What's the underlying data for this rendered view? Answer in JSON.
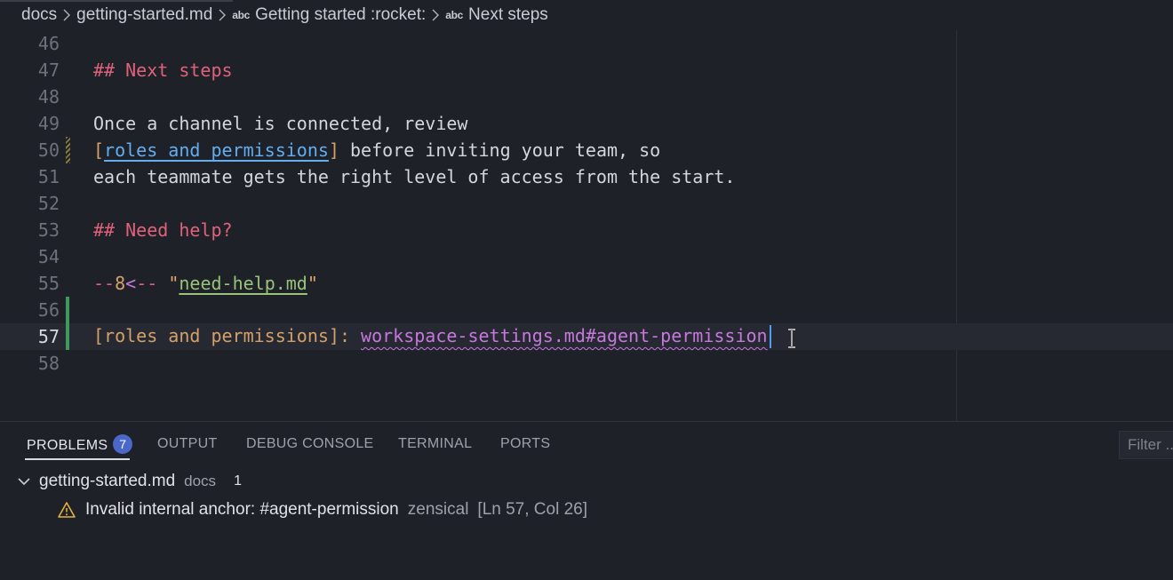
{
  "breadcrumb": {
    "items": [
      {
        "label": "docs",
        "symbol": ""
      },
      {
        "label": "getting-started.md",
        "symbol": ""
      },
      {
        "label": "Getting started :rocket:",
        "symbol": "abc"
      },
      {
        "label": "Next steps",
        "symbol": "abc"
      }
    ]
  },
  "editor": {
    "line_numbers": [
      "46",
      "47",
      "48",
      "49",
      "50",
      "51",
      "52",
      "53",
      "54",
      "55",
      "56",
      "57",
      "58"
    ],
    "current_line": "57",
    "lines": {
      "l47": "## Next steps",
      "l49": "Once a channel is connected, review",
      "l50_open": "[",
      "l50_link": "roles and permissions",
      "l50_close": "]",
      "l50_rest": " before inviting your team, so",
      "l51": "each teammate gets the right level of access from the start.",
      "l53": "## Need help?",
      "l55_dash": "--",
      "l55_num": "8",
      "l55_arrow": "<",
      "l55_dash2": "-- ",
      "l55_q1": "\"",
      "l55_file": "need-help.md",
      "l55_q2": "\"",
      "l57_ref": "[roles and permissions]:",
      "l57_url": "workspace-settings.md#agent-permission"
    }
  },
  "panel": {
    "tabs": [
      {
        "label": "PROBLEMS",
        "active": true
      },
      {
        "label": "OUTPUT",
        "active": false
      },
      {
        "label": "DEBUG CONSOLE",
        "active": false
      },
      {
        "label": "TERMINAL",
        "active": false
      },
      {
        "label": "PORTS",
        "active": false
      }
    ],
    "problems_count": "7",
    "filter_placeholder": "Filter ...",
    "file": {
      "name": "getting-started.md",
      "folder": "docs",
      "count": "1"
    },
    "problem": {
      "message": "Invalid internal anchor: #agent-permission",
      "source": "zensical",
      "location": "[Ln 57, Col 26]"
    }
  },
  "colors": {
    "background": "#1f2128",
    "heading": "#e0627a",
    "link": "#62aef0",
    "url": "#c678dd",
    "badge": "#4a67c9",
    "added_gutter": "#3c9a5c",
    "warning": "#e2b340"
  }
}
